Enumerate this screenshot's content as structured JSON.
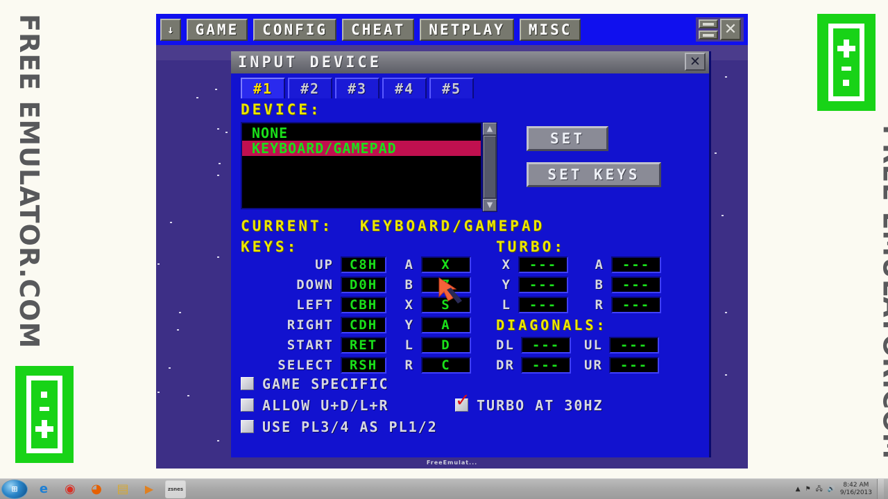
{
  "banners": {
    "left_text": "FREE EMULATOR.COM",
    "right_text": "FREE EMULATOR.COM",
    "logo_color": "#18d317"
  },
  "emulator": {
    "menu": {
      "dropdown_arrow": "↓",
      "items": [
        "GAME",
        "CONFIG",
        "CHEAT",
        "NETPLAY",
        "MISC"
      ],
      "window_buttons": {
        "maximize": "",
        "minimize": "",
        "close": "✕"
      }
    },
    "background_color": "#3d2f86"
  },
  "dialog": {
    "title": "INPUT DEVICE",
    "close_label": "✕",
    "tabs": [
      {
        "label": "#1",
        "active": true
      },
      {
        "label": "#2",
        "active": false
      },
      {
        "label": "#3",
        "active": false
      },
      {
        "label": "#4",
        "active": false
      },
      {
        "label": "#5",
        "active": false
      }
    ],
    "device": {
      "heading": "DEVICE:",
      "options": [
        {
          "label": "NONE",
          "selected": false
        },
        {
          "label": "KEYBOARD/GAMEPAD",
          "selected": true
        }
      ],
      "scroll_up": "▲",
      "scroll_down": "▼",
      "set_button": "SET",
      "set_keys_button": "SET KEYS"
    },
    "current": {
      "label": "CURRENT:",
      "value": "KEYBOARD/GAMEPAD"
    },
    "keys_heading": "KEYS:",
    "turbo_heading": "TURBO:",
    "diagonals_heading": "DIAGONALS:",
    "dpad_keys": [
      {
        "name": "UP",
        "value": "C8H"
      },
      {
        "name": "DOWN",
        "value": "D0H"
      },
      {
        "name": "LEFT",
        "value": "CBH"
      },
      {
        "name": "RIGHT",
        "value": "CDH"
      },
      {
        "name": "START",
        "value": "RET"
      },
      {
        "name": "SELECT",
        "value": "RSH"
      }
    ],
    "button_keys": [
      {
        "name": "A",
        "value": "X"
      },
      {
        "name": "B",
        "value": "Z"
      },
      {
        "name": "X",
        "value": "S"
      },
      {
        "name": "Y",
        "value": "A"
      },
      {
        "name": "L",
        "value": "D"
      },
      {
        "name": "R",
        "value": "C"
      }
    ],
    "turbo_left": [
      {
        "name": "X",
        "value": "---"
      },
      {
        "name": "Y",
        "value": "---"
      },
      {
        "name": "L",
        "value": "---"
      }
    ],
    "turbo_right": [
      {
        "name": "A",
        "value": "---"
      },
      {
        "name": "B",
        "value": "---"
      },
      {
        "name": "R",
        "value": "---"
      }
    ],
    "diagonals_left": [
      {
        "name": "DL",
        "value": "---"
      },
      {
        "name": "DR",
        "value": "---"
      }
    ],
    "diagonals_right": [
      {
        "name": "UL",
        "value": "---"
      },
      {
        "name": "UR",
        "value": "---"
      }
    ],
    "checkboxes": [
      {
        "label": "GAME SPECIFIC",
        "checked": false
      },
      {
        "label": "ALLOW U+D/L+R",
        "checked": false
      },
      {
        "label": "USE PL3/4 AS PL1/2",
        "checked": false
      }
    ],
    "turbo_checkbox": {
      "label": "TURBO AT 30HZ",
      "checked": true
    }
  },
  "status_text": "FreeEmulat...",
  "taskbar": {
    "start_label": "⊞",
    "items": [
      {
        "name": "internet-explorer",
        "glyph": "e",
        "color": "#1e7fd4",
        "active": false
      },
      {
        "name": "google-chrome",
        "glyph": "◉",
        "color": "#d93025",
        "active": false
      },
      {
        "name": "mozilla-firefox",
        "glyph": "◕",
        "color": "#e66000",
        "active": false
      },
      {
        "name": "windows-explorer",
        "glyph": "▤",
        "color": "#e8c04a",
        "active": false
      },
      {
        "name": "media-player",
        "glyph": "▶",
        "color": "#e08020",
        "active": false
      },
      {
        "name": "zsnes",
        "glyph": "zsnes",
        "color": "#3a9a3a",
        "active": true
      }
    ],
    "tray": {
      "chevron": "▲",
      "flag": "⚑",
      "network": "🖧",
      "volume": "🔊",
      "time": "8:42 AM",
      "date": "9/16/2013"
    }
  }
}
